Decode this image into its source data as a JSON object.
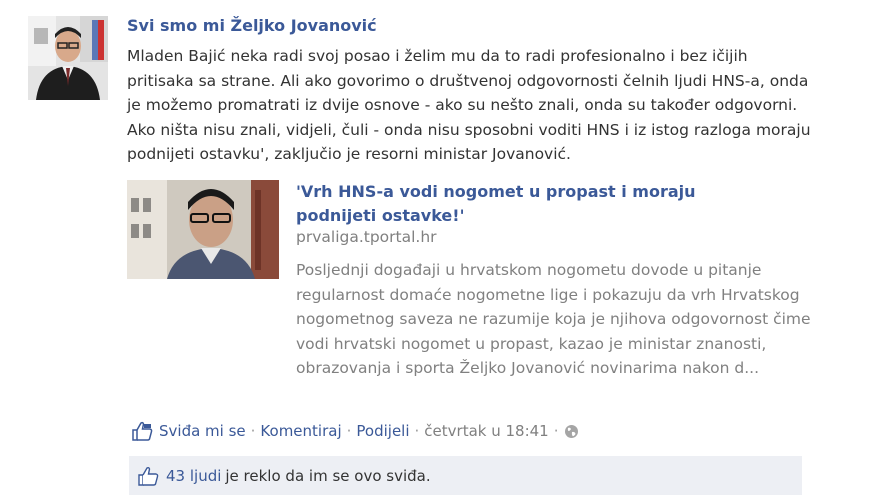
{
  "post": {
    "author": "Svi smo mi Željko Jovanović",
    "message": "Mladen Bajić neka radi svoj posao i želim mu da to radi profesionalno i bez ičijih pritisaka sa strane. Ali ako govorimo o društvenoj odgovornosti čelnih ljudi HNS-a, onda je možemo promatrati iz dvije osnove - ako su nešto znali, onda su također odgovorni. Ako ništa nisu znali, vidjeli, čuli - onda nisu sposobni voditi HNS i iz istog razloga moraju podnijeti ostavku', zaključio je resorni ministar Jovanović."
  },
  "shared_link": {
    "title": "'Vrh HNS-a vodi nogomet u propast i moraju podnijeti ostavke!'",
    "domain": "prvaliga.tportal.hr",
    "description": "Posljednji događaji u hrvatskom nogometu dovode u pitanje regularnost domaće nogometne lige i pokazuju da vrh Hrvatskog nogometnog saveza ne razumije koja je njihova odgovornost čime vodi hrvatski nogomet u propast, kazao je ministar znanosti, obrazovanja i sporta Željko Jovanović novinarima nakon d..."
  },
  "actions": {
    "like": "Sviđa mi se",
    "comment": "Komentiraj",
    "share": "Podijeli",
    "separator": "·",
    "timestamp": "četvrtak u 18:41"
  },
  "likes": {
    "count_link": "43 ljudi",
    "rest": "je reklo da im se ovo sviđa."
  },
  "colors": {
    "link": "#3b5998",
    "muted": "#808080",
    "likes_bg": "#edeff4"
  },
  "icons": {
    "like_action": "like-page-icon",
    "privacy": "globe-icon",
    "likes_box": "thumbs-up-icon"
  }
}
